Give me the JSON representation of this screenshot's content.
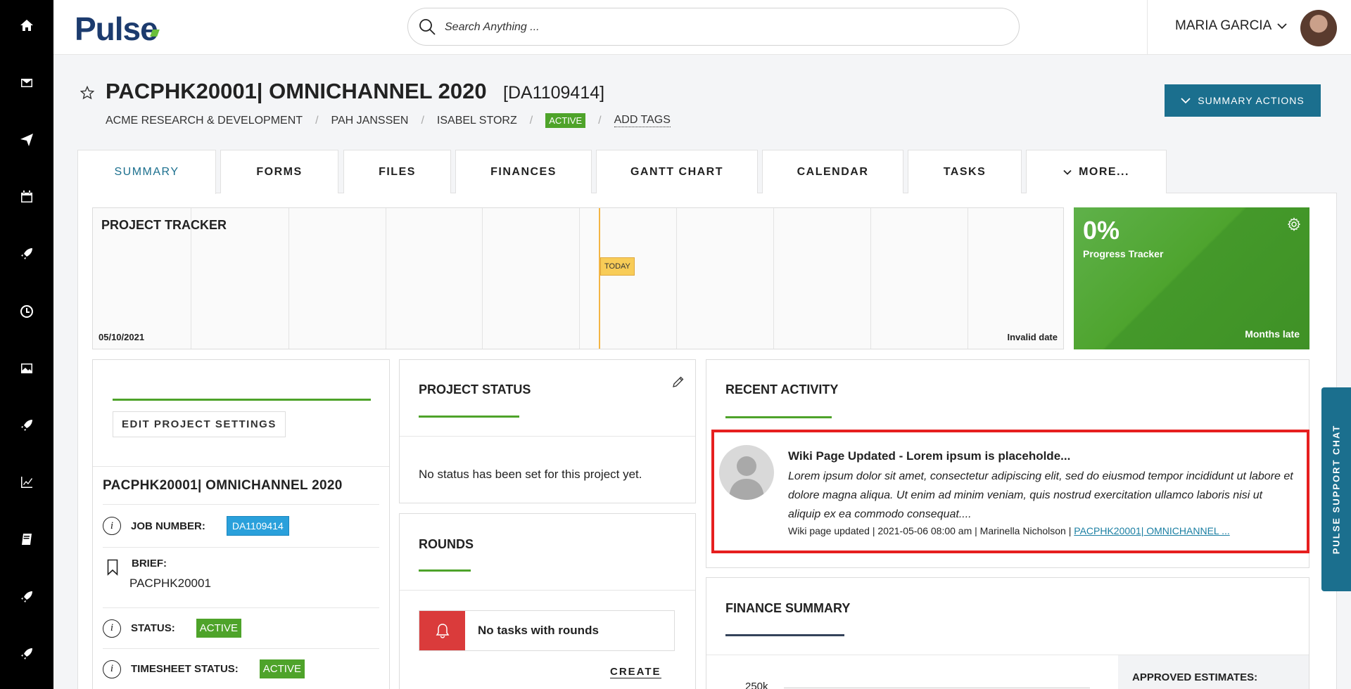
{
  "app": {
    "logo": "Pulse"
  },
  "search": {
    "placeholder": "Search Anything ..."
  },
  "user": {
    "name": "MARIA GARCIA"
  },
  "rail_icons": [
    "home-icon",
    "mail-icon",
    "send-icon",
    "calendar-icon",
    "rocket-icon",
    "clock-icon",
    "image-icon",
    "rocket-icon",
    "chart-icon",
    "book-icon",
    "rocket-icon",
    "rocket-icon"
  ],
  "header": {
    "title": "PACPHK20001| OMNICHANNEL 2020",
    "code": "[DA1109414]",
    "breadcrumbs": [
      "ACME RESEARCH & DEVELOPMENT",
      "PAH JANSSEN",
      "ISABEL STORZ"
    ],
    "status_badge": "ACTIVE",
    "add_tags": "ADD TAGS",
    "summary_actions": "SUMMARY ACTIONS"
  },
  "tabs": [
    "SUMMARY",
    "FORMS",
    "FILES",
    "FINANCES",
    "GANTT CHART",
    "CALENDAR",
    "TASKS",
    "MORE..."
  ],
  "tracker": {
    "title": "PROJECT TRACKER",
    "today_label": "TODAY",
    "start_date": "05/10/2021",
    "end_date": "Invalid date"
  },
  "progress": {
    "percent": "0%",
    "label": "Progress Tracker",
    "status": "Months late",
    "color": "#4ea42e"
  },
  "project_info": {
    "edit_button": "EDIT PROJECT SETTINGS",
    "name": "PACPHK20001| OMNICHANNEL 2020",
    "job_number_label": "JOB NUMBER:",
    "job_number": "DA1109414",
    "brief_label": "BRIEF:",
    "brief": "PACPHK20001",
    "status_label": "STATUS:",
    "status": "ACTIVE",
    "timesheet_label": "TIMESHEET STATUS:",
    "timesheet_status": "ACTIVE"
  },
  "project_status": {
    "title": "PROJECT STATUS",
    "message": "No status has been set for this project yet."
  },
  "rounds": {
    "title": "ROUNDS",
    "message": "No tasks with rounds",
    "create": "CREATE"
  },
  "recent_activity": {
    "title": "RECENT ACTIVITY",
    "item": {
      "title": "Wiki Page Updated - Lorem ipsum is placeholde...",
      "body": "Lorem ipsum dolor sit amet, consectetur adipiscing elit, sed do eiusmod tempor incididunt ut labore et dolore magna aliqua. Ut enim ad minim veniam, quis nostrud exercitation ullamco laboris nisi ut aliquip ex ea commodo consequat....",
      "meta": "Wiki page updated | 2021-05-06 08:00 am | Marinella Nicholson | ",
      "link": "PACPHK20001| OMNICHANNEL ..."
    }
  },
  "finance_summary": {
    "title": "FINANCE SUMMARY",
    "approved_estimates": "APPROVED ESTIMATES:",
    "axis_top": "250k"
  },
  "support_chat": {
    "label": "PULSE SUPPORT CHAT"
  },
  "colors": {
    "brand": "#1b6f8e",
    "accent_green": "#4ea32a",
    "highlight_red": "#e61f1f"
  }
}
